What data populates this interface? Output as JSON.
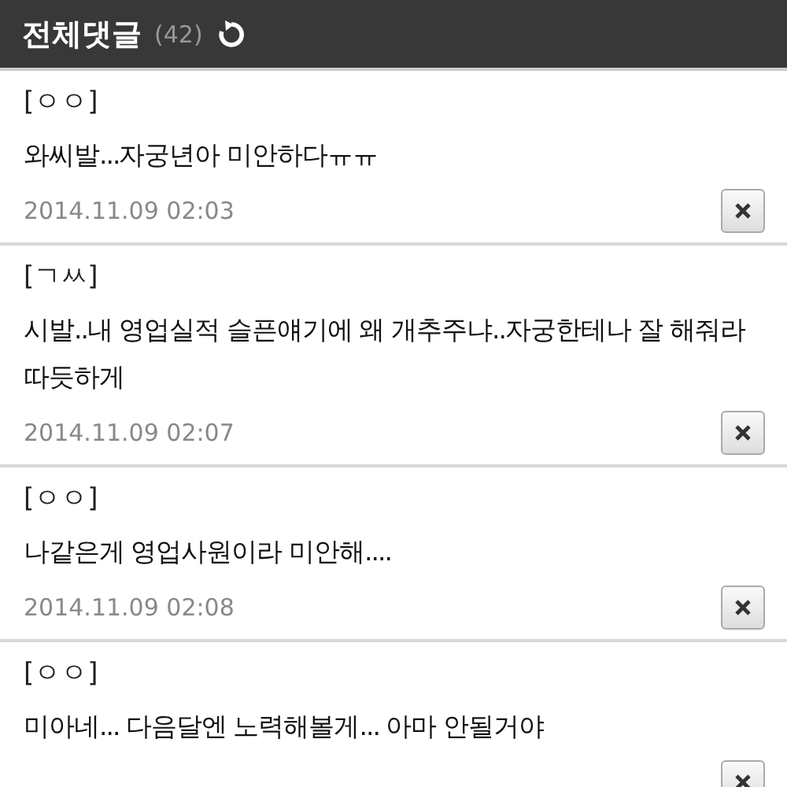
{
  "header": {
    "title": "전체댓글",
    "count": "(42)"
  },
  "comments": [
    {
      "author": "[ㅇㅇ]",
      "text": "와씨발...자궁년아 미안하다ㅠㅠ",
      "date": "2014.11.09 02:03"
    },
    {
      "author": "[ㄱㅆ]",
      "text": "시발..내 영업실적 슬픈얘기에 왜 개추주냐..자궁한테나 잘 해줘라 따듯하게",
      "date": "2014.11.09 02:07"
    },
    {
      "author": "[ㅇㅇ]",
      "text": "나같은게 영업사원이라 미안해....",
      "date": "2014.11.09 02:08"
    },
    {
      "author": "[ㅇㅇ]",
      "text": "미아네... 다음달엔 노력해볼게... 아마 안될거야"
    }
  ]
}
